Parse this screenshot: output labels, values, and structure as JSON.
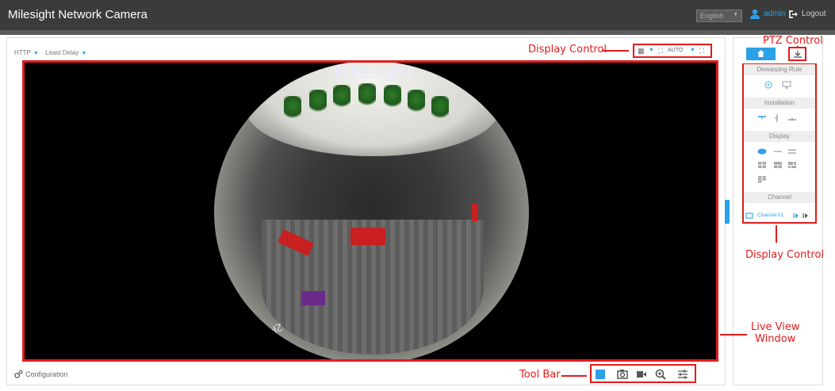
{
  "header": {
    "title": "Milesight Network Camera",
    "language": "English",
    "user": "admin",
    "logout": "Logout"
  },
  "stream": {
    "protocol": "HTTP",
    "mode": "Least Delay"
  },
  "display_toolbar": {
    "zoom_label": "AUTO"
  },
  "video": {
    "logo_text": "Milesight",
    "floor_text": "2F"
  },
  "footer": {
    "configuration": "Configuration"
  },
  "side": {
    "dewarping_rule": "Dewarping Rule",
    "installation": "Installation",
    "display": "Display",
    "channel": "Channel",
    "channel_name": "Channel 01"
  },
  "annotations": {
    "display_control_top": "Display Control",
    "ptz_control": "PTZ Control",
    "display_control_side": "Display Control",
    "live_view": "Live View\nWindow",
    "tool_bar": "Tool Bar"
  },
  "colors": {
    "accent": "#2aa0e6",
    "annotation": "#e21c1c",
    "topbar": "#3b3b3b"
  }
}
